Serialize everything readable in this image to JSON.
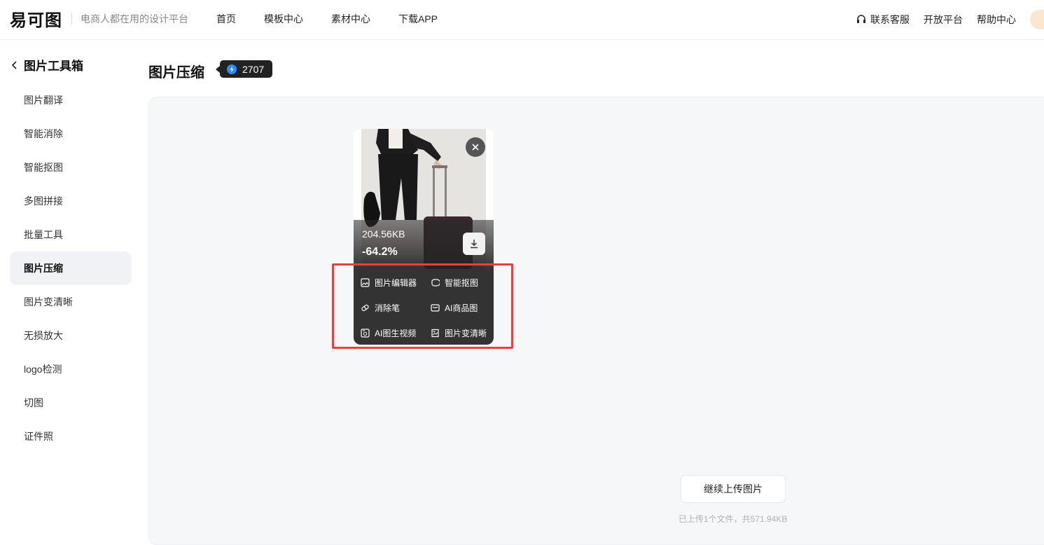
{
  "header": {
    "logo_text": "易可图",
    "slogan": "电商人都在用的设计平台",
    "nav": [
      "首页",
      "模板中心",
      "素材中心",
      "下载APP"
    ],
    "right_nav": [
      "联系客服",
      "开放平台",
      "帮助中心"
    ]
  },
  "sidebar": {
    "title": "图片工具箱",
    "items": [
      "图片翻译",
      "智能消除",
      "智能抠图",
      "多图拼接",
      "批量工具",
      "图片压缩",
      "图片变清晰",
      "无损放大",
      "logo检测",
      "切图",
      "证件照"
    ],
    "active_index": 5
  },
  "main": {
    "title": "图片压缩",
    "credits": "2707",
    "card": {
      "size": "204.56KB",
      "ratio": "-64.2%",
      "actions": [
        {
          "label": "图片编辑器",
          "icon": "image-icon"
        },
        {
          "label": "智能抠图",
          "icon": "cutout-icon"
        },
        {
          "label": "消除笔",
          "icon": "eraser-icon"
        },
        {
          "label": "AI商品图",
          "icon": "product-icon"
        },
        {
          "label": "AI图生视频",
          "icon": "video-icon"
        },
        {
          "label": "图片变清晰",
          "icon": "hd-icon"
        }
      ]
    },
    "upload_button": "继续上传图片",
    "upload_summary": "已上传1个文件，共571.94KB"
  },
  "colors": {
    "highlight": "#e8413c",
    "badge_bg": "#222222",
    "bolt": "#2b8cff",
    "actions_bg": "#333333"
  }
}
